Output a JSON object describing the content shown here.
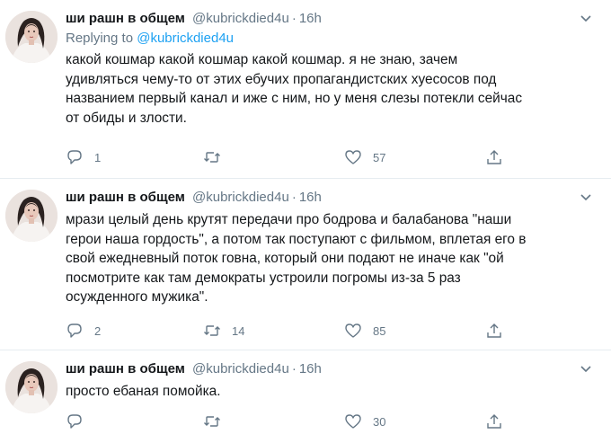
{
  "tweets": [
    {
      "display_name": "ши рашн в общем",
      "handle": "@kubrickdied4u",
      "separator": "·",
      "time": "16h",
      "replying_to_label": "Replying to",
      "replying_to_handle": "@kubrickdied4u",
      "text": "какой кошмар какой кошмар какой кошмар. я не знаю, зачем\nудивляться чему-то от этих ебучих пропагандистских хуесосов под\nназванием первый канал и иже с ним, но у меня слезы потекли сейчас\nот обиды и злости.",
      "reply_count": "1",
      "retweet_count": "",
      "like_count": "57"
    },
    {
      "display_name": "ши рашн в общем",
      "handle": "@kubrickdied4u",
      "separator": "·",
      "time": "16h",
      "text": "мрази целый день крутят передачи про бодрова и балабанова \"наши\nгерои наша гордость\", а потом так поступают с фильмом, вплетая его в\nсвой ежедневный поток говна, который они подают не иначе как \"ой\nпосмотрите как там демократы устроили погромы из-за 5 раз\nосужденного мужика\".",
      "reply_count": "2",
      "retweet_count": "14",
      "like_count": "85"
    },
    {
      "display_name": "ши рашн в общем",
      "handle": "@kubrickdied4u",
      "separator": "·",
      "time": "16h",
      "text": "просто ебаная помойка.",
      "reply_count": "",
      "retweet_count": "",
      "like_count": "30"
    }
  ],
  "icons": {
    "reply": "reply-icon",
    "retweet": "retweet-icon",
    "like": "heart-icon",
    "share": "share-icon",
    "menu": "chevron-down-icon"
  },
  "colors": {
    "text": "#14171a",
    "muted": "#657786",
    "link": "#1da1f2",
    "divider": "#e6ecf0"
  }
}
